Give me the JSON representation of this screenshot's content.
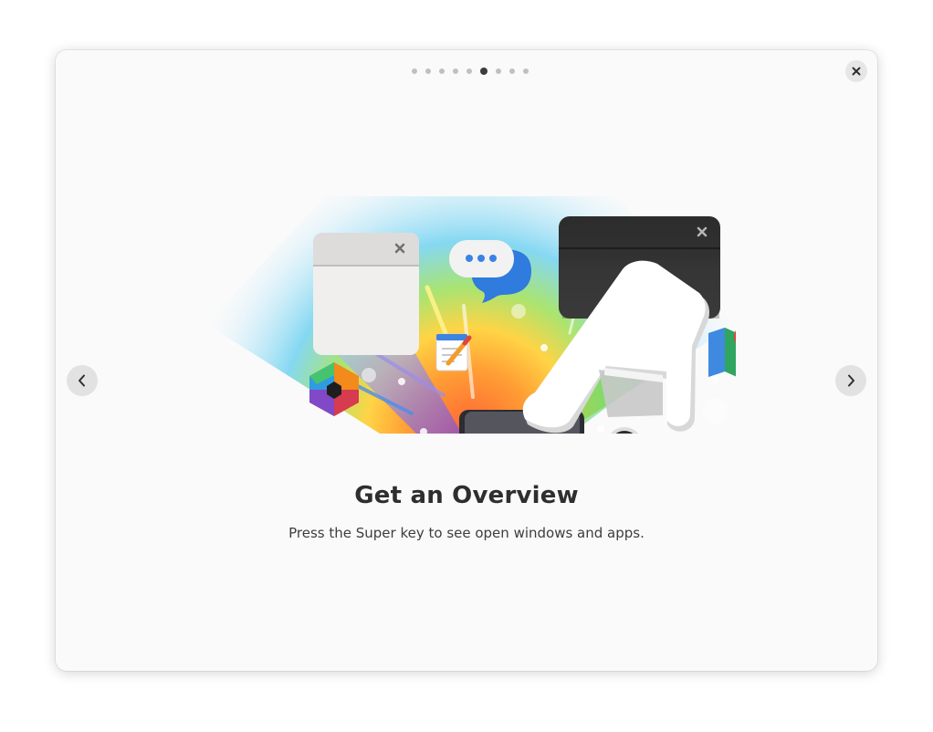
{
  "pager": {
    "total": 9,
    "active_index": 5
  },
  "slide": {
    "title": "Get an Overview",
    "description": "Press the Super key to see open windows and apps."
  },
  "controls": {
    "close_icon": "close-icon",
    "prev_icon": "chevron-left-icon",
    "next_icon": "chevron-right-icon"
  },
  "colors": {
    "window_bg": "#fafafa",
    "button_bg": "#e2e2e2",
    "active_dot": "#3d3d3d",
    "inactive_dot": "#c0c0c0"
  }
}
